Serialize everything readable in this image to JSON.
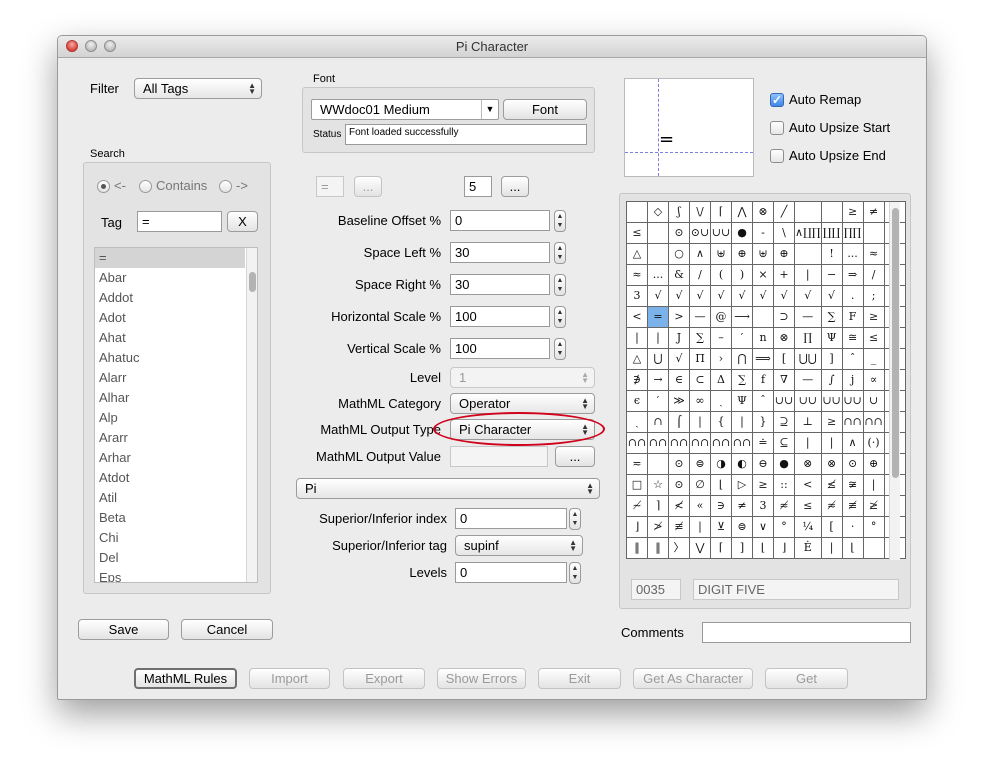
{
  "window": {
    "title": "Pi Character"
  },
  "filter": {
    "label": "Filter",
    "value": "All Tags"
  },
  "font": {
    "group_label": "Font",
    "selected": "WWdoc01 Medium",
    "button": "Font",
    "status_label": "Status",
    "status_value": "Font loaded successfully"
  },
  "search": {
    "group_label": "Search",
    "radio_prev": "<-",
    "radio_contains": "Contains",
    "radio_next": "->",
    "tag_label": "Tag",
    "tag_value": "=",
    "clear_button": "X",
    "items": [
      "=",
      "Abar",
      "Addot",
      "Adot",
      "Ahat",
      "Ahatuc",
      "Alarr",
      "Alhar",
      "Alp",
      "Ararr",
      "Arhar",
      "Atdot",
      "Atil",
      "Beta",
      "Chi",
      "Del",
      "Eps"
    ],
    "selected_index": 0
  },
  "char_row": {
    "char_value": "=",
    "char_button": "...",
    "index_value": "5",
    "index_button": "..."
  },
  "params": {
    "baseline_offset": {
      "label": "Baseline Offset %",
      "value": "0"
    },
    "space_left": {
      "label": "Space Left %",
      "value": "30"
    },
    "space_right": {
      "label": "Space Right %",
      "value": "30"
    },
    "horizontal_scale": {
      "label": "Horizontal Scale %",
      "value": "100"
    },
    "vertical_scale": {
      "label": "Vertical Scale %",
      "value": "100"
    },
    "level": {
      "label": "Level",
      "value": "1"
    }
  },
  "mathml": {
    "category_label": "MathML Category",
    "category_value": "Operator",
    "output_type_label": "MathML Output Type",
    "output_type_value": "Pi Character",
    "output_value_label": "MathML Output Value",
    "output_value": "",
    "output_value_button": "..."
  },
  "pi_popup": {
    "value": "Pi"
  },
  "sup_inf": {
    "index_label": "Superior/Inferior index",
    "index_value": "0",
    "tag_label": "Superior/Inferior tag",
    "tag_value": "supinf",
    "levels_label": "Levels",
    "levels_value": "0"
  },
  "preview": {
    "glyph": "="
  },
  "options": {
    "auto_remap": {
      "label": "Auto Remap",
      "checked": true
    },
    "auto_upsize_start": {
      "label": "Auto Upsize Start",
      "checked": false
    },
    "auto_upsize_end": {
      "label": "Auto Upsize End",
      "checked": false
    }
  },
  "char_grid": {
    "rows": [
      [
        "",
        "◇",
        "ʃ",
        "\\/",
        "⌈",
        "⋀",
        "⊗",
        "╱",
        "",
        "",
        "≥",
        "≠",
        ""
      ],
      [
        "≤",
        "",
        "⊙",
        "⊙∪",
        "∪∪",
        "●",
        "-",
        "\\",
        "∧∐∏",
        "∐∐",
        "∏∏",
        "",
        ""
      ],
      [
        "△",
        "",
        "○",
        "∧",
        "⊎",
        "⊕",
        "⊎",
        "⊕",
        "",
        "!",
        "...",
        "≈",
        ""
      ],
      [
        "≈",
        "...",
        "&",
        "/",
        "(",
        ")",
        "×",
        "+",
        "|",
        "−",
        "⇒",
        "/",
        ""
      ],
      [
        "3",
        "√",
        "√",
        "√",
        "√",
        "√",
        "√",
        "√",
        "√",
        "√",
        ".",
        ";",
        ""
      ],
      [
        "<",
        "=",
        ">",
        "—",
        "@",
        "⟶",
        "",
        "⊃",
        "—",
        "∑",
        "F",
        "≥",
        ""
      ],
      [
        "|",
        "|",
        "J",
        "∑",
        "–",
        "′",
        "n",
        "⊗",
        "∏",
        "Ψ",
        "≅",
        "≤",
        ""
      ],
      [
        "△",
        "⋃",
        "√",
        "Π",
        "›",
        "⋂",
        "⟹",
        "[",
        "⋃⋃",
        "]",
        "ˆ",
        "_",
        ""
      ],
      [
        "∌",
        "→",
        "∈",
        "⊂",
        "Δ",
        "∑",
        "f",
        "∇",
        "—",
        "∫",
        "j",
        "∝",
        ""
      ],
      [
        "ϵ",
        "′",
        "≫",
        "∞",
        "ˏ",
        "Ψ",
        "ˆ",
        "∪∪",
        "∪∪",
        "∪∪",
        "∪∪",
        "∪",
        ""
      ],
      [
        "ˏ",
        "∩",
        "⌠",
        "|",
        "{",
        "|",
        "}",
        "⊇",
        "⊥",
        "≥",
        "∩∩",
        "∩∩",
        ""
      ],
      [
        "∩∩",
        "∩∩",
        "∩∩",
        "∩∩",
        "∩∩",
        "∩∩",
        "≐",
        "⊆",
        "|",
        "|",
        "∧",
        "(·)",
        "◁"
      ],
      [
        "≂",
        "",
        "⊙",
        "⊜",
        "◑",
        "◐",
        "⊖",
        "●",
        "⊗",
        "⊗",
        "⊙",
        "⊕",
        ""
      ],
      [
        "□",
        "☆",
        "⊙",
        "∅",
        "⌊",
        "▷",
        "≥",
        "::",
        "<",
        "≰",
        "≆",
        "|",
        ""
      ],
      [
        "≁",
        "⌉",
        "≮",
        "«",
        "∋",
        "≠",
        "3",
        "≉",
        "≤",
        "≉",
        "≢",
        "≱",
        ""
      ],
      [
        "⌋",
        "≯",
        "≢",
        "|",
        "⊻",
        "⊜",
        "∨",
        "°",
        "¼",
        "[",
        "·",
        "°",
        ""
      ],
      [
        "‖",
        "‖",
        "〉",
        "⋁",
        "⌈",
        "]",
        "⌊",
        "⌋",
        "Ė",
        "|",
        "⌊",
        "",
        ""
      ]
    ],
    "selected": [
      5,
      1
    ],
    "code_value": "0035",
    "name_value": "DIGIT FIVE"
  },
  "comments": {
    "label": "Comments",
    "value": ""
  },
  "buttons": {
    "save": "Save",
    "cancel": "Cancel",
    "mathml_rules": "MathML Rules",
    "import": "Import",
    "export": "Export",
    "show_errors": "Show Errors",
    "exit": "Exit",
    "get_as_character": "Get As Character",
    "get": "Get"
  },
  "colors": {
    "highlight_ellipse": "#d0021b",
    "selected_cell": "#7bb2ea",
    "checkbox_on": "#3f88e3"
  }
}
